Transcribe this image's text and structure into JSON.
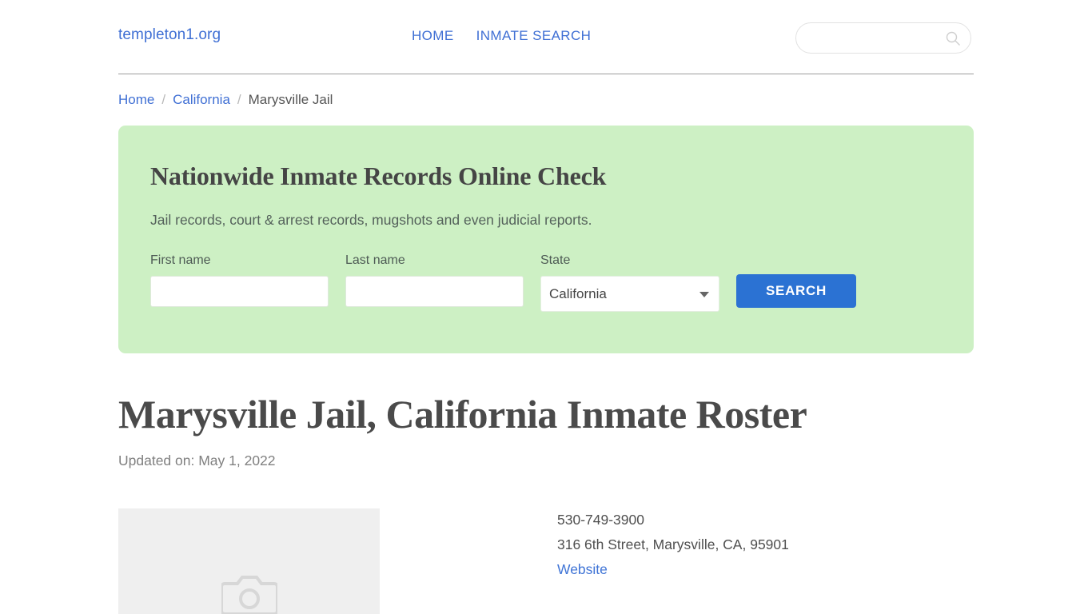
{
  "header": {
    "logo": "templeton1.org",
    "nav": [
      {
        "label": "HOME"
      },
      {
        "label": "INMATE SEARCH"
      }
    ],
    "search": {
      "value": "",
      "placeholder": ""
    }
  },
  "breadcrumb": {
    "items": [
      {
        "label": "Home",
        "link": true
      },
      {
        "label": "California",
        "link": true
      },
      {
        "label": "Marysville Jail",
        "link": false
      }
    ],
    "separator": "/"
  },
  "banner": {
    "title": "Nationwide Inmate Records Online Check",
    "subtitle": "Jail records, court & arrest records, mugshots and even judicial reports.",
    "first_name": {
      "label": "First name",
      "value": "",
      "placeholder": ""
    },
    "last_name": {
      "label": "Last name",
      "value": "",
      "placeholder": ""
    },
    "state": {
      "label": "State",
      "value": "California",
      "options": [
        "California"
      ]
    },
    "search_button": "SEARCH",
    "bg_color": "#cdf0c4",
    "button_color": "#2b72d3"
  },
  "main": {
    "title": "Marysville Jail, California Inmate Roster",
    "updated": "Updated on: May 1, 2022",
    "photo_placeholder_icon": "camera-icon",
    "contact": {
      "phone": "530-749-3900",
      "address": "316 6th Street, Marysville, CA, 95901",
      "website_label": "Website"
    }
  }
}
